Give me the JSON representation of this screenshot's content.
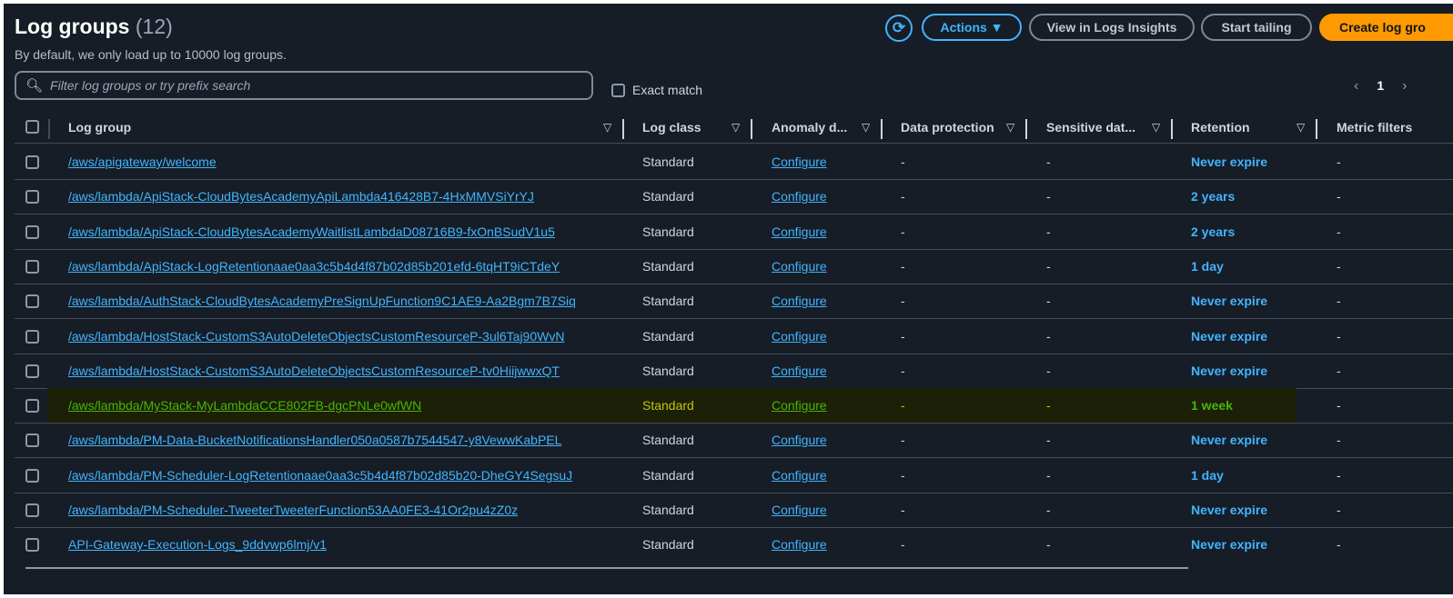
{
  "header": {
    "title": "Log groups",
    "count": "(12)",
    "subtitle": "By default, we only load up to 10000 log groups."
  },
  "toolbar": {
    "actions": "Actions ▼",
    "view_insights": "View in Logs Insights",
    "start_tailing": "Start tailing",
    "create": "Create log gro"
  },
  "search": {
    "placeholder": "Filter log groups or try prefix search",
    "exact_match": "Exact match"
  },
  "pagination": {
    "page": "1"
  },
  "columns": [
    "Log group",
    "Log class",
    "Anomaly d...",
    "Data protection",
    "Sensitive dat...",
    "Retention",
    "Metric filters"
  ],
  "colors": {
    "accent": "#42b4ff",
    "primary_button": "#ff9900",
    "highlight_row": "#1b2006"
  },
  "rows": [
    {
      "name": "/aws/apigateway/welcome",
      "class": "Standard",
      "anomaly": "Configure",
      "dp": "-",
      "sens": "-",
      "retention": "Never expire",
      "mf": "-"
    },
    {
      "name": "/aws/lambda/ApiStack-CloudBytesAcademyApiLambda416428B7-4HxMMVSiYrYJ",
      "class": "Standard",
      "anomaly": "Configure",
      "dp": "-",
      "sens": "-",
      "retention": "2 years",
      "mf": "-"
    },
    {
      "name": "/aws/lambda/ApiStack-CloudBytesAcademyWaitlistLambdaD08716B9-fxOnBSudV1u5",
      "class": "Standard",
      "anomaly": "Configure",
      "dp": "-",
      "sens": "-",
      "retention": "2 years",
      "mf": "-"
    },
    {
      "name": "/aws/lambda/ApiStack-LogRetentionaae0aa3c5b4d4f87b02d85b201efd-6tqHT9iCTdeY",
      "class": "Standard",
      "anomaly": "Configure",
      "dp": "-",
      "sens": "-",
      "retention": "1 day",
      "mf": "-"
    },
    {
      "name": "/aws/lambda/AuthStack-CloudBytesAcademyPreSignUpFunction9C1AE9-Aa2Bgm7B7Siq",
      "class": "Standard",
      "anomaly": "Configure",
      "dp": "-",
      "sens": "-",
      "retention": "Never expire",
      "mf": "-"
    },
    {
      "name": "/aws/lambda/HostStack-CustomS3AutoDeleteObjectsCustomResourceP-3ul6Taj90WvN",
      "class": "Standard",
      "anomaly": "Configure",
      "dp": "-",
      "sens": "-",
      "retention": "Never expire",
      "mf": "-"
    },
    {
      "name": "/aws/lambda/HostStack-CustomS3AutoDeleteObjectsCustomResourceP-tv0HiijwwxQT",
      "class": "Standard",
      "anomaly": "Configure",
      "dp": "-",
      "sens": "-",
      "retention": "Never expire",
      "mf": "-"
    },
    {
      "name": "/aws/lambda/MyStack-MyLambdaCCE802FB-dgcPNLe0wfWN",
      "class": "Standard",
      "anomaly": "Configure",
      "dp": "-",
      "sens": "-",
      "retention": "1 week",
      "mf": "-",
      "highlighted": true
    },
    {
      "name": "/aws/lambda/PM-Data-BucketNotificationsHandler050a0587b7544547-y8VewwKabPEL",
      "class": "Standard",
      "anomaly": "Configure",
      "dp": "-",
      "sens": "-",
      "retention": "Never expire",
      "mf": "-"
    },
    {
      "name": "/aws/lambda/PM-Scheduler-LogRetentionaae0aa3c5b4d4f87b02d85b20-DheGY4SegsuJ",
      "class": "Standard",
      "anomaly": "Configure",
      "dp": "-",
      "sens": "-",
      "retention": "1 day",
      "mf": "-"
    },
    {
      "name": "/aws/lambda/PM-Scheduler-TweeterTweeterFunction53AA0FE3-41Or2pu4zZ0z",
      "class": "Standard",
      "anomaly": "Configure",
      "dp": "-",
      "sens": "-",
      "retention": "Never expire",
      "mf": "-"
    },
    {
      "name": "API-Gateway-Execution-Logs_9ddvwp6lmj/v1",
      "class": "Standard",
      "anomaly": "Configure",
      "dp": "-",
      "sens": "-",
      "retention": "Never expire",
      "mf": "-"
    }
  ]
}
